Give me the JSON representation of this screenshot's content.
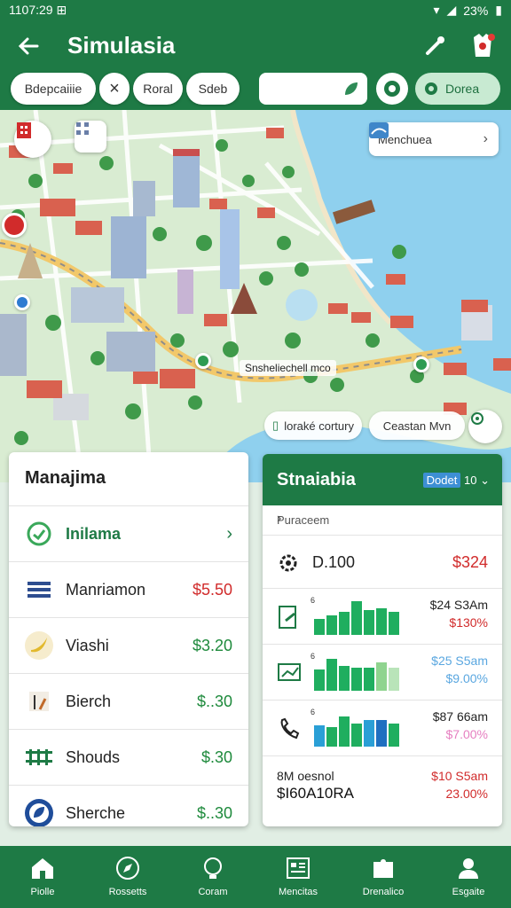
{
  "status": {
    "time": "1107:29 ⊞",
    "battery": "23%"
  },
  "appbar": {
    "title": "Simulasia"
  },
  "filters": {
    "chip1": "Bdepcaiiie",
    "chip2": "Roral",
    "chip3": "Sdeb",
    "green_chip": "Dorea"
  },
  "map": {
    "nearby_label": "Menchuea",
    "street_label": "Snsheliechell mco",
    "label_left": "loraké cortury",
    "label_right": "Ceastan Mvn"
  },
  "left_card": {
    "title": "Manajima",
    "items": [
      {
        "label": "Inilama",
        "amount": ""
      },
      {
        "label": "Manriamon",
        "amount": "$5.50",
        "color": "#d12b2b"
      },
      {
        "label": "Viashi",
        "amount": "$3.20",
        "color": "#1e8a3c"
      },
      {
        "label": "Bierch",
        "amount": "$..30",
        "color": "#1e8a3c"
      },
      {
        "label": "Shouds",
        "amount": "$.30",
        "color": "#1e8a3c"
      },
      {
        "label": "Sherche",
        "amount": "$..30",
        "color": "#1e8a3c"
      }
    ]
  },
  "right_card": {
    "title": "Stnaiabia",
    "selector_hl": "Dodet",
    "selector_rest": "10",
    "sub_label": "Puraceem",
    "top_value": "D.100",
    "top_amount": "$324",
    "rows": [
      {
        "axis": "6",
        "amount": "$24 S3Am",
        "pct": "$130%",
        "pct_color": "#d12b2b"
      },
      {
        "axis": "6",
        "amount": "$25 S5am",
        "pct": "$9.00%",
        "pct_color": "#5aa7e0"
      },
      {
        "axis": "6",
        "amount": "$87 66am",
        "pct": "$7.00%",
        "pct_color": "#e67fc0"
      }
    ],
    "footer_l1": "8M oesnol",
    "footer_l2": "$I60A10RA",
    "footer_r1": "$10 S5am",
    "footer_r2": "23.00%"
  },
  "bottom_nav": [
    {
      "label": "Piolle",
      "icon": "home-icon"
    },
    {
      "label": "Rossetts",
      "icon": "compass-icon"
    },
    {
      "label": "Coram",
      "icon": "bulb-icon"
    },
    {
      "label": "Mencitas",
      "icon": "board-icon"
    },
    {
      "label": "Drenalico",
      "icon": "puzzle-icon"
    },
    {
      "label": "Esgaite",
      "icon": "person-icon"
    }
  ]
}
